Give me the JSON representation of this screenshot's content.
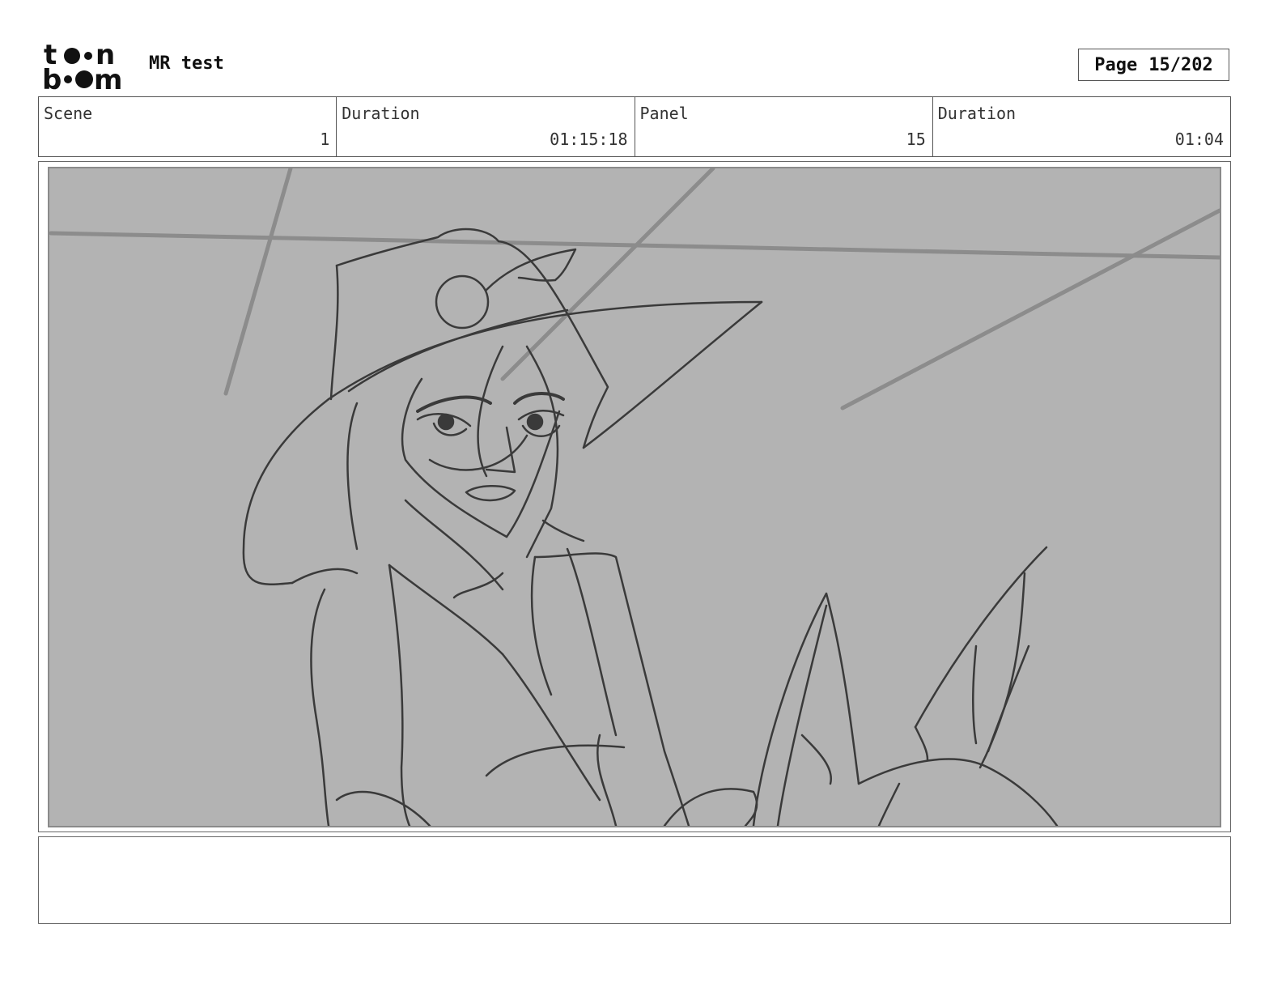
{
  "header": {
    "logo": "Toon Boom",
    "logo_icon": "toon-boom-logo",
    "project_title": "MR test",
    "page_label": "Page",
    "page_value": "15/202"
  },
  "info": {
    "scene_label": "Scene",
    "scene_value": "1",
    "scene_duration_label": "Duration",
    "scene_duration_value": "01:15:18",
    "panel_label": "Panel",
    "panel_value": "15",
    "panel_duration_label": "Duration",
    "panel_duration_value": "01:04"
  },
  "panel": {
    "background": "#b3b3b3",
    "sketch_color": "#3a3a3a"
  },
  "notes": {
    "text": ""
  }
}
